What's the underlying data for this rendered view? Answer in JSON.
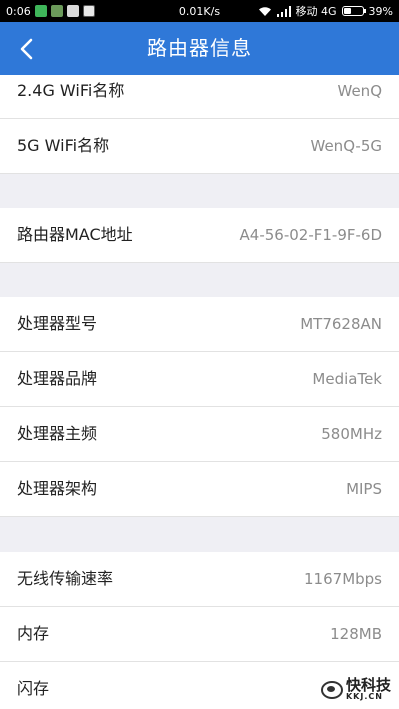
{
  "status_bar": {
    "time": "0:06",
    "net_speed": "0.01K/s",
    "carrier": "移动 4G",
    "battery_percent": "39%",
    "battery_level": 0.39,
    "notification_icons": [
      "wechat-icon",
      "message-icon",
      "app-icon",
      "qq-icon"
    ]
  },
  "app_bar": {
    "title": "路由器信息",
    "back_icon": "chevron-left-icon",
    "color": "#2f78d8"
  },
  "groups": [
    {
      "rows": [
        {
          "label": "2.4G WiFi名称",
          "value": "WenQ"
        },
        {
          "label": "5G WiFi名称",
          "value": "WenQ-5G"
        }
      ]
    },
    {
      "rows": [
        {
          "label": "路由器MAC地址",
          "value": "A4-56-02-F1-9F-6D"
        }
      ]
    },
    {
      "rows": [
        {
          "label": "处理器型号",
          "value": "MT7628AN"
        },
        {
          "label": "处理器品牌",
          "value": "MediaTek"
        },
        {
          "label": "处理器主频",
          "value": "580MHz"
        },
        {
          "label": "处理器架构",
          "value": "MIPS"
        }
      ]
    },
    {
      "rows": [
        {
          "label": "无线传输速率",
          "value": "1167Mbps"
        },
        {
          "label": "内存",
          "value": "128MB"
        },
        {
          "label": "闪存",
          "value": ""
        }
      ]
    }
  ],
  "watermark": {
    "main": "快科技",
    "sub": "KKJ.CN"
  }
}
